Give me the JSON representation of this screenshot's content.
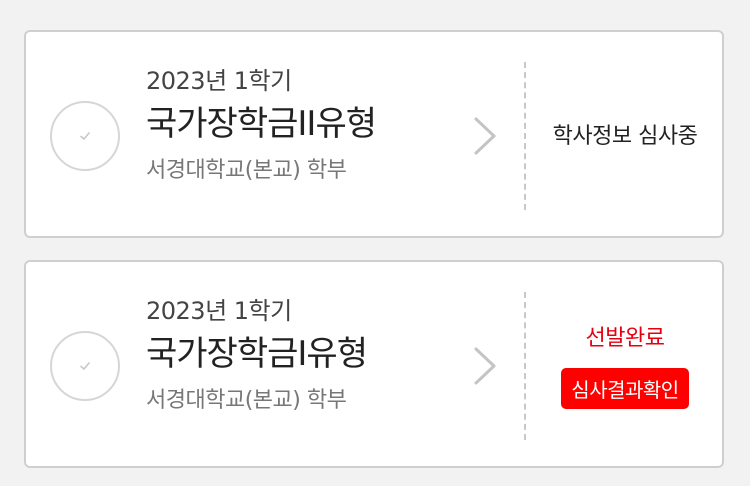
{
  "cards": [
    {
      "term": "2023년 1학기",
      "name": "국가장학금II유형",
      "school": "서경대학교(본교) 학부",
      "status": "학사정보 심사중"
    },
    {
      "term": "2023년 1학기",
      "name": "국가장학금I유형",
      "school": "서경대학교(본교) 학부",
      "status": "선발완료",
      "action": "심사결과확인"
    }
  ],
  "icons": {
    "check": "check-icon",
    "chevron": "chevron-right-icon"
  },
  "colors": {
    "selected_status": "#e60012",
    "action_button": "#ff0000"
  }
}
